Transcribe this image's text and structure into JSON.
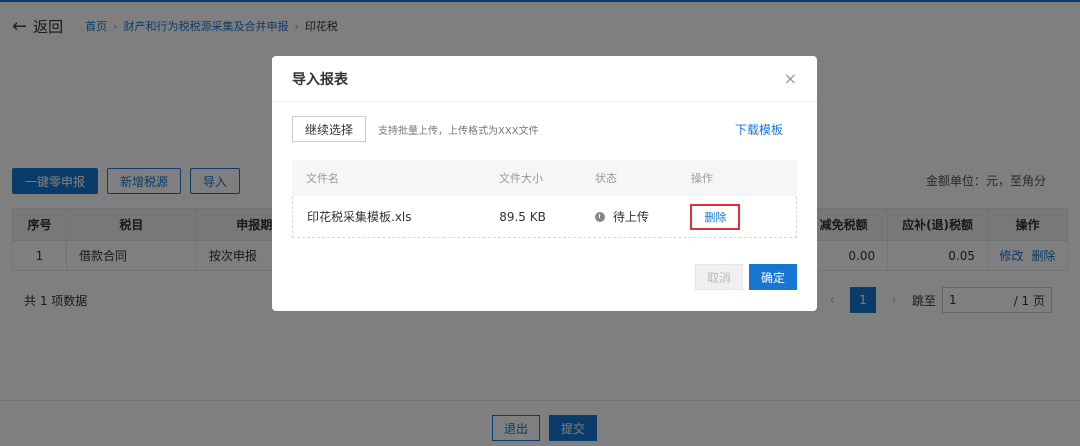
{
  "header": {
    "back_label": "返回",
    "breadcrumb": [
      "首页",
      "财产和行为税税源采集及合并申报",
      "印花税"
    ]
  },
  "toolbar": {
    "zero_report_label": "一键零申报",
    "add_source_label": "新增税源",
    "import_label": "导入",
    "unit_note": "金额单位：元，至角分"
  },
  "table": {
    "columns": [
      "序号",
      "税目",
      "申报期限类",
      "减免税额",
      "应补(退)税额",
      "操作"
    ],
    "rows": [
      {
        "index": "1",
        "item": "借款合同",
        "period": "按次申报",
        "relief": "0.00",
        "payable": "0.05",
        "edit": "修改",
        "delete": "删除"
      }
    ],
    "total_text": "共 1 项数据"
  },
  "pager": {
    "current": "1",
    "jump_label": "跳至",
    "jump_value": "1",
    "pages_text": "/ 1 页"
  },
  "footer": {
    "exit_label": "退出",
    "submit_label": "提交"
  },
  "modal": {
    "title": "导入报表",
    "continue_label": "继续选择",
    "hint": "支持批量上传，上传格式为XXX文件",
    "download_label": "下载模板",
    "columns": [
      "文件名",
      "文件大小",
      "状态",
      "操作"
    ],
    "file": {
      "name": "印花税采集模板.xls",
      "size": "89.5 KB",
      "status": "待上传",
      "action": "删除"
    },
    "cancel_label": "取消",
    "ok_label": "确定"
  },
  "colors": {
    "primary": "#1677d2",
    "highlight": "#e0313b"
  }
}
